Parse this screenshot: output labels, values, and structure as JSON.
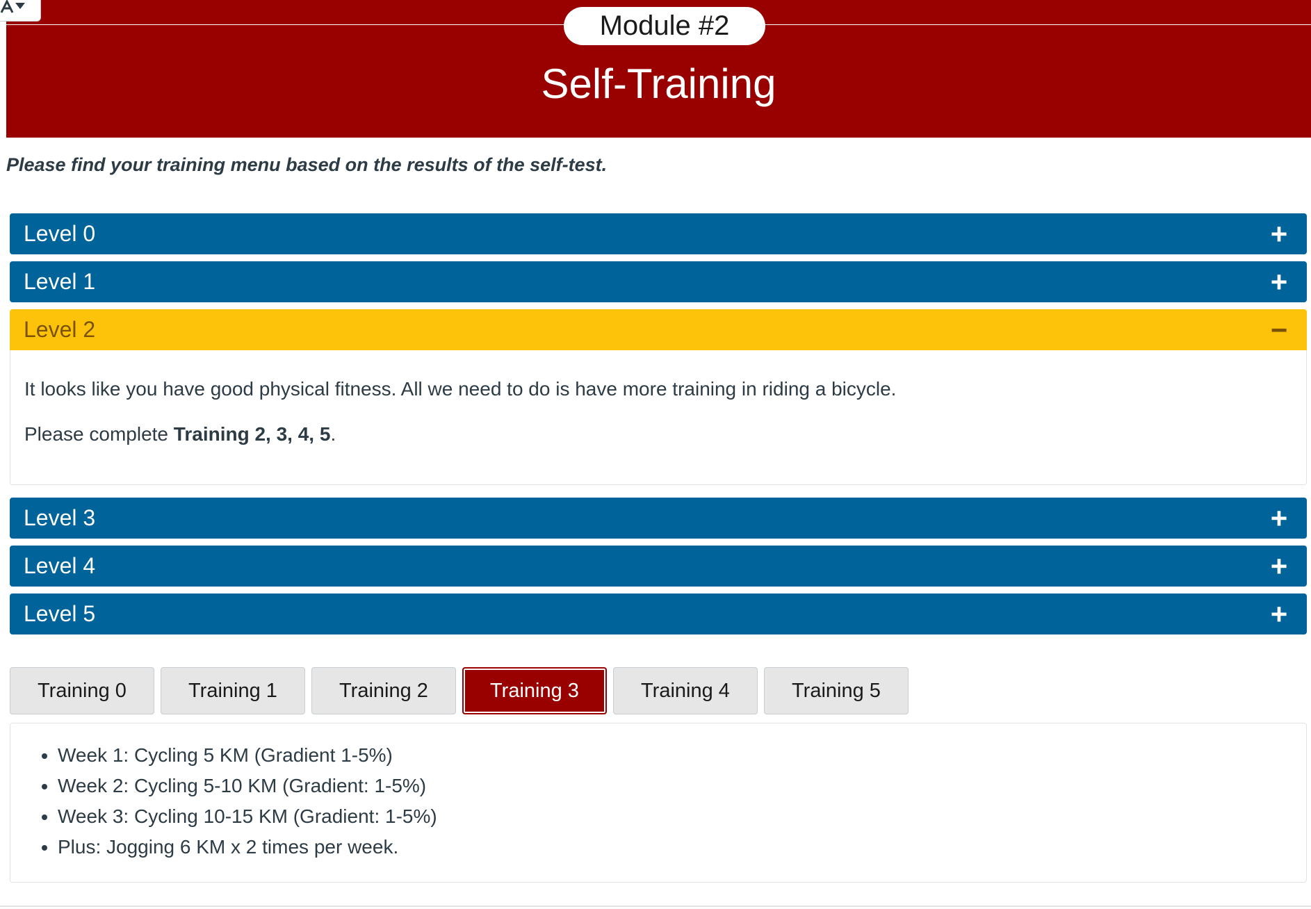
{
  "banner": {
    "module_label": "Module #2",
    "title": "Self-Training",
    "color": "#990000"
  },
  "intro_text": "Please find your training menu based on the results of the self-test.",
  "accordion": {
    "items": [
      {
        "label": "Level 0",
        "icon": "plus-icon",
        "symbol": "+"
      },
      {
        "label": "Level 1",
        "icon": "plus-icon",
        "symbol": "+"
      },
      {
        "label": "Level 2",
        "icon": "minus-icon",
        "symbol": "−",
        "open": true,
        "body_line_1": "It looks like you have good physical fitness. All we need to do is have more training in riding a bicycle.",
        "body_line_2_prefix": "Please complete ",
        "body_line_2_bold": "Training 2, 3, 4, 5",
        "body_line_2_suffix": "."
      },
      {
        "label": "Level 3",
        "icon": "plus-icon",
        "symbol": "+"
      },
      {
        "label": "Level 4",
        "icon": "plus-icon",
        "symbol": "+"
      },
      {
        "label": "Level 5",
        "icon": "plus-icon",
        "symbol": "+"
      }
    ],
    "colors": {
      "closed": "#00639a",
      "open": "#fdc30b"
    }
  },
  "tabs": {
    "items": [
      "Training 0",
      "Training 1",
      "Training 2",
      "Training 3",
      "Training 4",
      "Training 5"
    ],
    "active": "Training 3"
  },
  "tab_panel": {
    "list": [
      "Week 1: Cycling 5 KM (Gradient 1-5%)",
      "Week 2: Cycling 5-10 KM (Gradient: 1-5%)",
      "Week 3: Cycling 10-15 KM (Gradient: 1-5%)",
      "Plus: Jogging 6 KM x 2 times per week."
    ]
  }
}
